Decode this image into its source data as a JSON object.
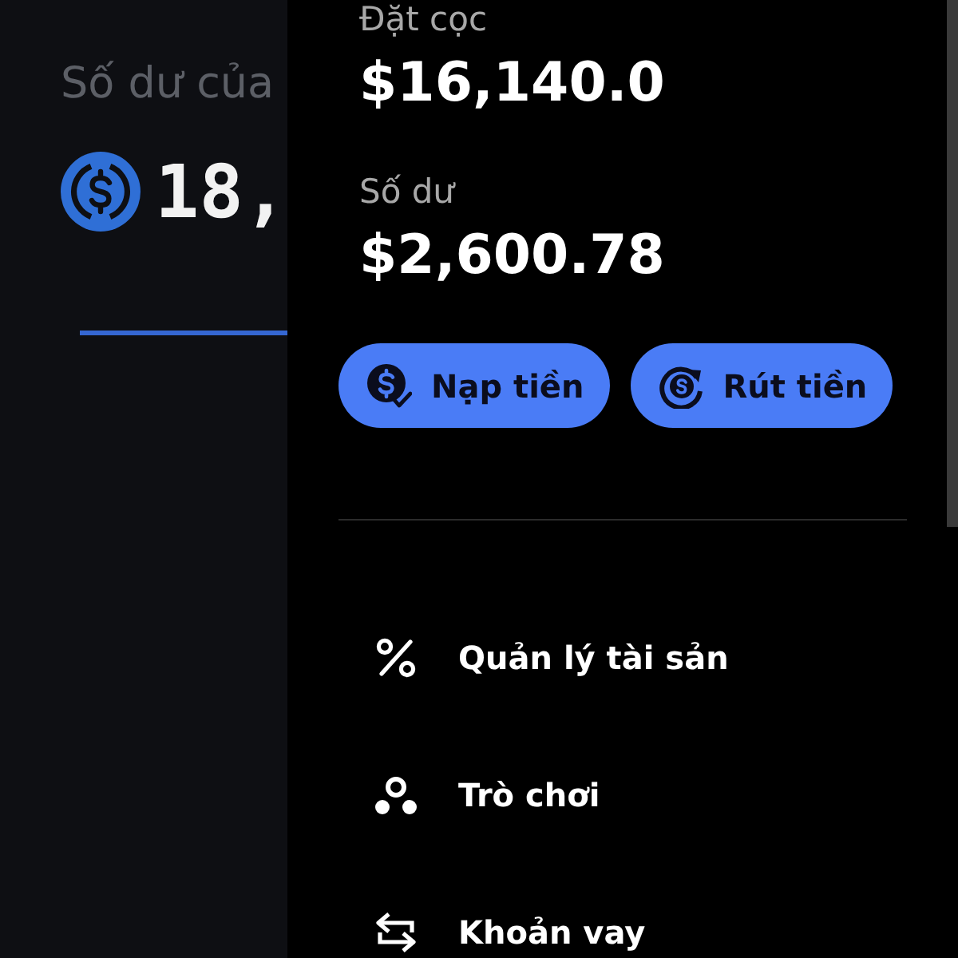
{
  "background": {
    "balance_label": "Số dư của",
    "balance_amount": "18,"
  },
  "drawer": {
    "stats": [
      {
        "label": "Đặt cọc",
        "value": "$16,140.0"
      },
      {
        "label": "Số dư",
        "value": "$2,600.78"
      }
    ],
    "buttons": [
      {
        "label": "Nạp tiền",
        "kind": "deposit"
      },
      {
        "label": "Rút tiền",
        "kind": "withdraw"
      }
    ],
    "menu": [
      {
        "label": "Quản lý tài sản",
        "kind": "percent"
      },
      {
        "label": "Trò chơi",
        "kind": "games"
      },
      {
        "label": "Khoản vay",
        "kind": "loan"
      }
    ]
  }
}
